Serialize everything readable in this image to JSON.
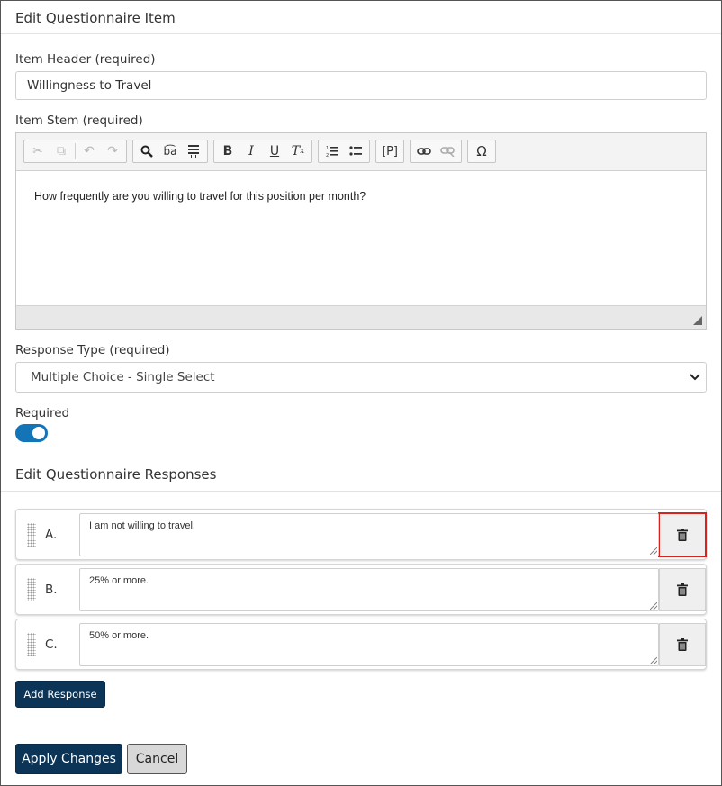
{
  "colors": {
    "primary": "#0c3456",
    "toggle_on": "#1474b8",
    "highlight": "#d9221c"
  },
  "panel": {
    "title": "Edit Questionnaire Item"
  },
  "item_header": {
    "label": "Item Header (required)",
    "value": "Willingness to Travel"
  },
  "item_stem": {
    "label": "Item Stem (required)",
    "content": "How frequently are you willing to travel for this position per month?",
    "toolbar": [
      [
        "cut-icon",
        "copy-icon"
      ],
      [
        "undo-icon",
        "redo-icon"
      ],
      [
        "find-icon",
        "replace-icon",
        "select-all-icon"
      ],
      [
        "bold-icon",
        "italic-icon",
        "underline-icon",
        "remove-format-icon"
      ],
      [
        "numbered-list-icon",
        "bulleted-list-icon"
      ],
      [
        "paragraph-icon"
      ],
      [
        "link-icon",
        "unlink-icon"
      ],
      [
        "special-character-icon"
      ]
    ]
  },
  "response_type": {
    "label": "Response Type (required)",
    "selected": "Multiple Choice - Single Select"
  },
  "required": {
    "label": "Required",
    "on": true
  },
  "responses_section": {
    "title": "Edit Questionnaire Responses"
  },
  "responses": [
    {
      "letter": "A.",
      "text": "I am not willing to travel."
    },
    {
      "letter": "B.",
      "text": "25% or more."
    },
    {
      "letter": "C.",
      "text": "50% or more."
    }
  ],
  "buttons": {
    "add_response": "Add Response",
    "apply": "Apply Changes",
    "cancel": "Cancel"
  }
}
